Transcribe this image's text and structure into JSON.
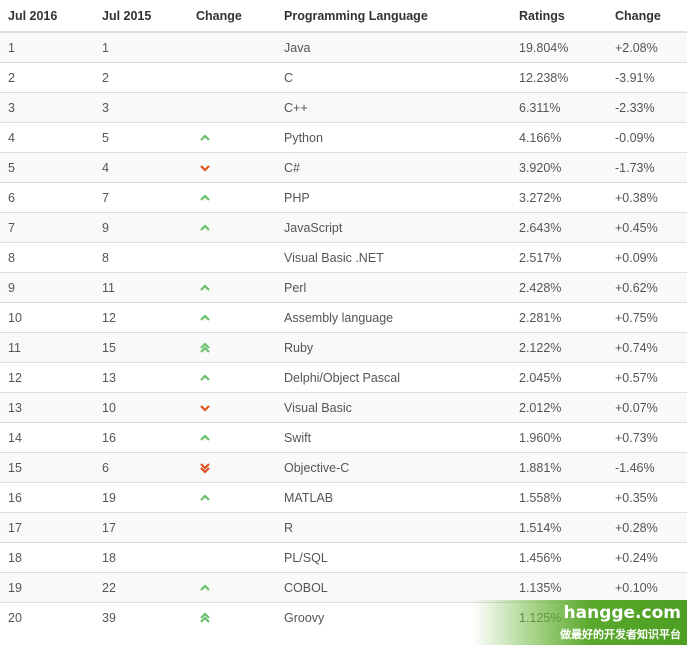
{
  "table": {
    "headers": [
      "Jul 2016",
      "Jul 2015",
      "Change",
      "Programming Language",
      "Ratings",
      "Change"
    ],
    "rows": [
      {
        "rank2016": "1",
        "rank2015": "1",
        "trend": "none",
        "language": "Java",
        "rating": "19.804%",
        "change": "+2.08%"
      },
      {
        "rank2016": "2",
        "rank2015": "2",
        "trend": "none",
        "language": "C",
        "rating": "12.238%",
        "change": "-3.91%"
      },
      {
        "rank2016": "3",
        "rank2015": "3",
        "trend": "none",
        "language": "C++",
        "rating": "6.311%",
        "change": "-2.33%"
      },
      {
        "rank2016": "4",
        "rank2015": "5",
        "trend": "up",
        "language": "Python",
        "rating": "4.166%",
        "change": "-0.09%"
      },
      {
        "rank2016": "5",
        "rank2015": "4",
        "trend": "down",
        "language": "C#",
        "rating": "3.920%",
        "change": "-1.73%"
      },
      {
        "rank2016": "6",
        "rank2015": "7",
        "trend": "up",
        "language": "PHP",
        "rating": "3.272%",
        "change": "+0.38%"
      },
      {
        "rank2016": "7",
        "rank2015": "9",
        "trend": "up",
        "language": "JavaScript",
        "rating": "2.643%",
        "change": "+0.45%"
      },
      {
        "rank2016": "8",
        "rank2015": "8",
        "trend": "none",
        "language": "Visual Basic .NET",
        "rating": "2.517%",
        "change": "+0.09%"
      },
      {
        "rank2016": "9",
        "rank2015": "11",
        "trend": "up",
        "language": "Perl",
        "rating": "2.428%",
        "change": "+0.62%"
      },
      {
        "rank2016": "10",
        "rank2015": "12",
        "trend": "up",
        "language": "Assembly language",
        "rating": "2.281%",
        "change": "+0.75%"
      },
      {
        "rank2016": "11",
        "rank2015": "15",
        "trend": "double-up",
        "language": "Ruby",
        "rating": "2.122%",
        "change": "+0.74%"
      },
      {
        "rank2016": "12",
        "rank2015": "13",
        "trend": "up",
        "language": "Delphi/Object Pascal",
        "rating": "2.045%",
        "change": "+0.57%"
      },
      {
        "rank2016": "13",
        "rank2015": "10",
        "trend": "down",
        "language": "Visual Basic",
        "rating": "2.012%",
        "change": "+0.07%"
      },
      {
        "rank2016": "14",
        "rank2015": "16",
        "trend": "up",
        "language": "Swift",
        "rating": "1.960%",
        "change": "+0.73%"
      },
      {
        "rank2016": "15",
        "rank2015": "6",
        "trend": "double-down",
        "language": "Objective-C",
        "rating": "1.881%",
        "change": "-1.46%"
      },
      {
        "rank2016": "16",
        "rank2015": "19",
        "trend": "up",
        "language": "MATLAB",
        "rating": "1.558%",
        "change": "+0.35%"
      },
      {
        "rank2016": "17",
        "rank2015": "17",
        "trend": "none",
        "language": "R",
        "rating": "1.514%",
        "change": "+0.28%"
      },
      {
        "rank2016": "18",
        "rank2015": "18",
        "trend": "none",
        "language": "PL/SQL",
        "rating": "1.456%",
        "change": "+0.24%"
      },
      {
        "rank2016": "19",
        "rank2015": "22",
        "trend": "up",
        "language": "COBOL",
        "rating": "1.135%",
        "change": "+0.10%"
      },
      {
        "rank2016": "20",
        "rank2015": "39",
        "trend": "double-up",
        "language": "Groovy",
        "rating": "1.125%",
        "change": ""
      }
    ]
  },
  "colors": {
    "up": "#6abf69",
    "down": "#e2531f"
  },
  "watermark": {
    "title": "hangge.com",
    "subtitle": "做最好的开发者知识平台"
  }
}
